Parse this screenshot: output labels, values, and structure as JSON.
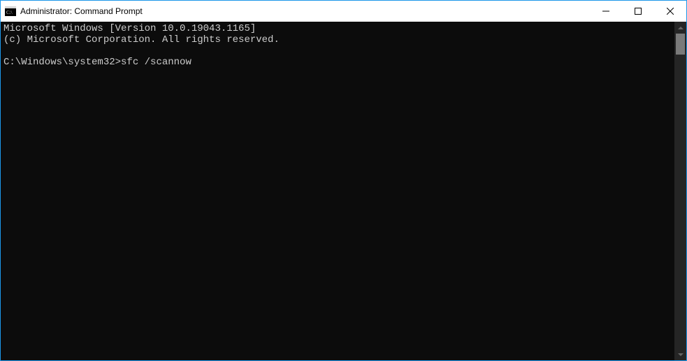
{
  "window": {
    "title": "Administrator: Command Prompt"
  },
  "console": {
    "line1": "Microsoft Windows [Version 10.0.19043.1165]",
    "line2": "(c) Microsoft Corporation. All rights reserved.",
    "blank": "",
    "prompt": "C:\\Windows\\system32>",
    "command": "sfc /scannow"
  }
}
